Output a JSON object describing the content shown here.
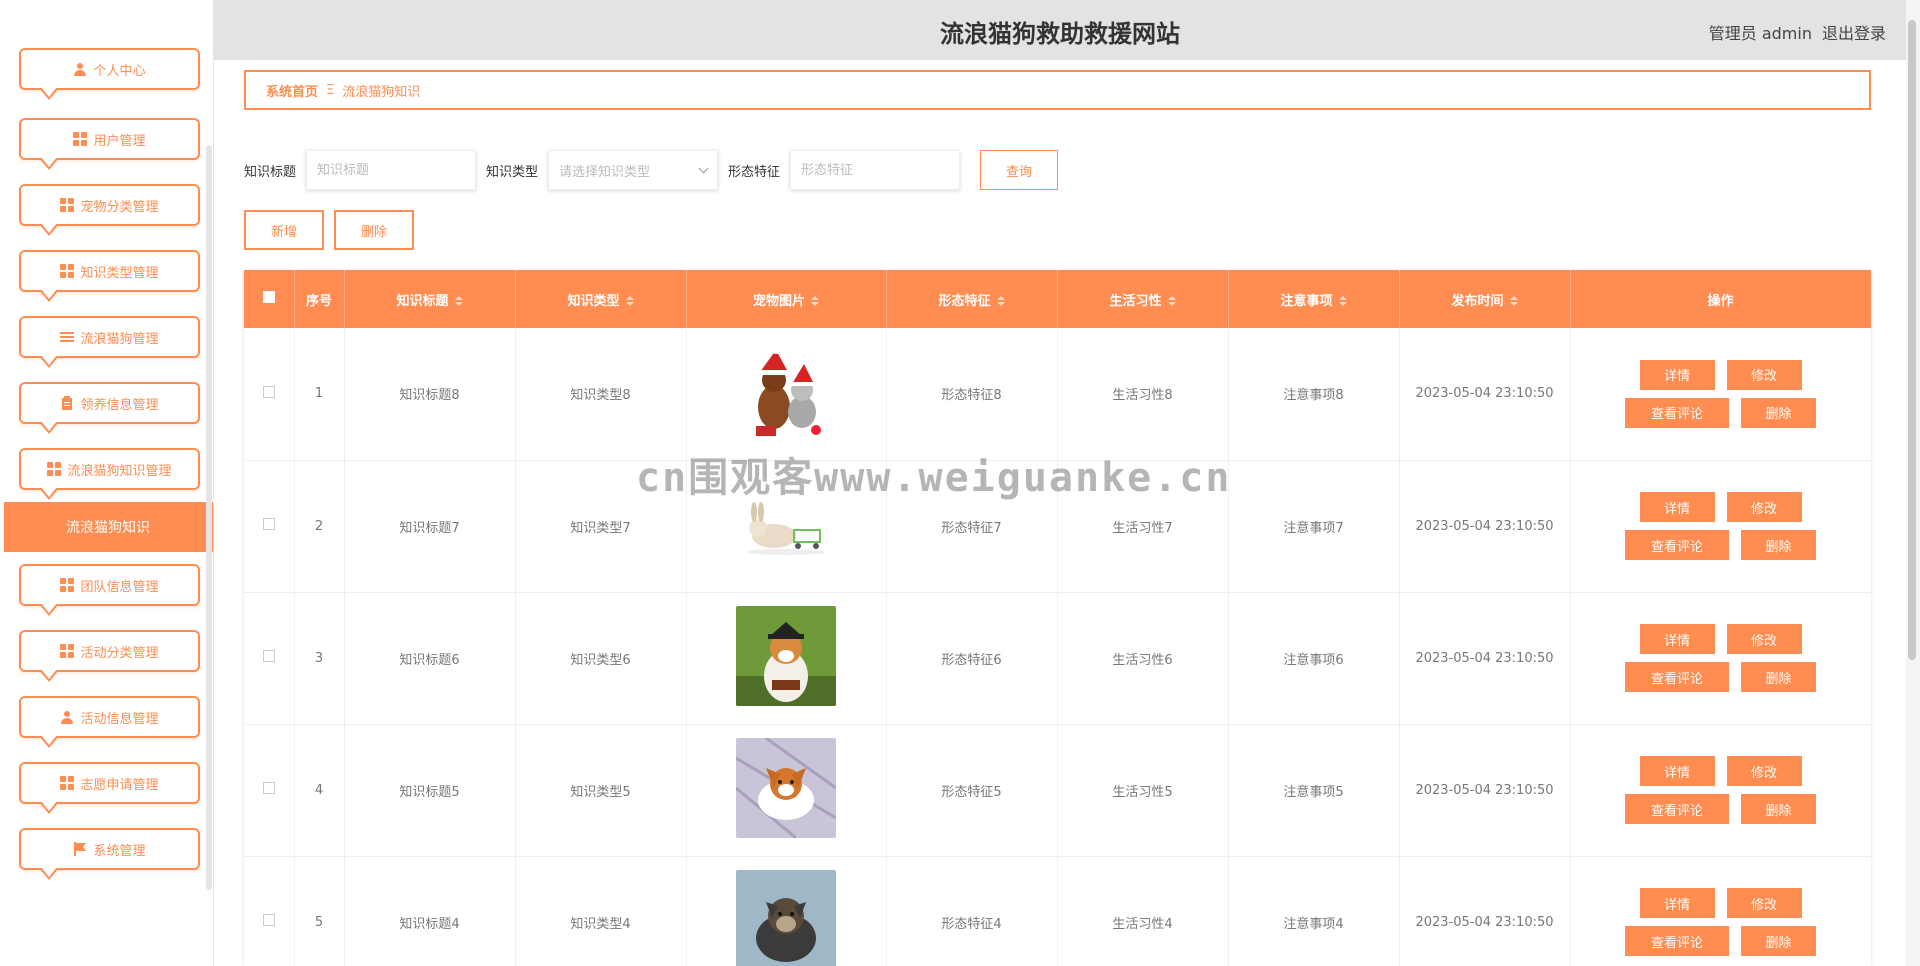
{
  "header": {
    "site_title": "流浪猫狗救助救援网站",
    "user_label": "管理员 admin",
    "logout": "退出登录"
  },
  "sidebar": {
    "items": [
      {
        "label": "个人中心",
        "icon": "user-icon"
      },
      {
        "label": "用户管理",
        "icon": "grid-icon"
      },
      {
        "label": "宠物分类管理",
        "icon": "grid-icon"
      },
      {
        "label": "知识类型管理",
        "icon": "grid-icon"
      },
      {
        "label": "流浪猫狗管理",
        "icon": "list-icon"
      },
      {
        "label": "领养信息管理",
        "icon": "clipboard-icon"
      },
      {
        "label": "流浪猫狗知识管理",
        "icon": "grid-icon"
      },
      {
        "label": "团队信息管理",
        "icon": "grid-icon"
      },
      {
        "label": "活动分类管理",
        "icon": "grid-icon"
      },
      {
        "label": "活动信息管理",
        "icon": "user-icon"
      },
      {
        "label": "志愿申请管理",
        "icon": "grid-icon"
      },
      {
        "label": "系统管理",
        "icon": "flag-icon"
      }
    ],
    "active_sub": "流浪猫狗知识"
  },
  "breadcrumb": {
    "home": "系统首页",
    "separator": "Ξ",
    "current": "流浪猫狗知识"
  },
  "search": {
    "title_label": "知识标题",
    "title_placeholder": "知识标题",
    "type_label": "知识类型",
    "type_placeholder": "请选择知识类型",
    "feature_label": "形态特征",
    "feature_placeholder": "形态特征",
    "query": "查询"
  },
  "actions": {
    "add": "新增",
    "delete": "删除"
  },
  "table": {
    "headers": [
      "序号",
      "知识标题",
      "知识类型",
      "宠物图片",
      "形态特征",
      "生活习性",
      "注意事项",
      "发布时间",
      "操作"
    ],
    "row_actions": {
      "detail": "详情",
      "edit": "修改",
      "comments": "查看评论",
      "delete": "删除"
    },
    "rows": [
      {
        "index": "1",
        "title": "知识标题8",
        "type": "知识类型8",
        "feature": "形态特征8",
        "habit": "生活习性8",
        "notes": "注意事项8",
        "time": "2023-05-04 23:10:50",
        "image": "dog-and-cat-santa-hats"
      },
      {
        "index": "2",
        "title": "知识标题7",
        "type": "知识类型7",
        "feature": "形态特征7",
        "habit": "生活习性7",
        "notes": "注意事项7",
        "time": "2023-05-04 23:10:50",
        "image": "rabbit-with-cart"
      },
      {
        "index": "3",
        "title": "知识标题6",
        "type": "知识类型6",
        "feature": "形态特征6",
        "habit": "生活习性6",
        "notes": "注意事项6",
        "time": "2023-05-04 23:10:50",
        "image": "corgi-with-hat"
      },
      {
        "index": "4",
        "title": "知识标题5",
        "type": "知识类型5",
        "feature": "形态特征5",
        "habit": "生活习性5",
        "notes": "注意事项5",
        "time": "2023-05-04 23:10:50",
        "image": "chihuahua-on-blanket"
      },
      {
        "index": "5",
        "title": "知识标题4",
        "type": "知识类型4",
        "feature": "形态特征4",
        "habit": "生活习性4",
        "notes": "注意事项4",
        "time": "2023-05-04 23:10:50",
        "image": "yorkie-puppy"
      }
    ]
  },
  "watermark": "cn围观客www.weiguanke.cn",
  "colors": {
    "accent": "#ff8c50",
    "header_bg": "#e3e3e3"
  }
}
